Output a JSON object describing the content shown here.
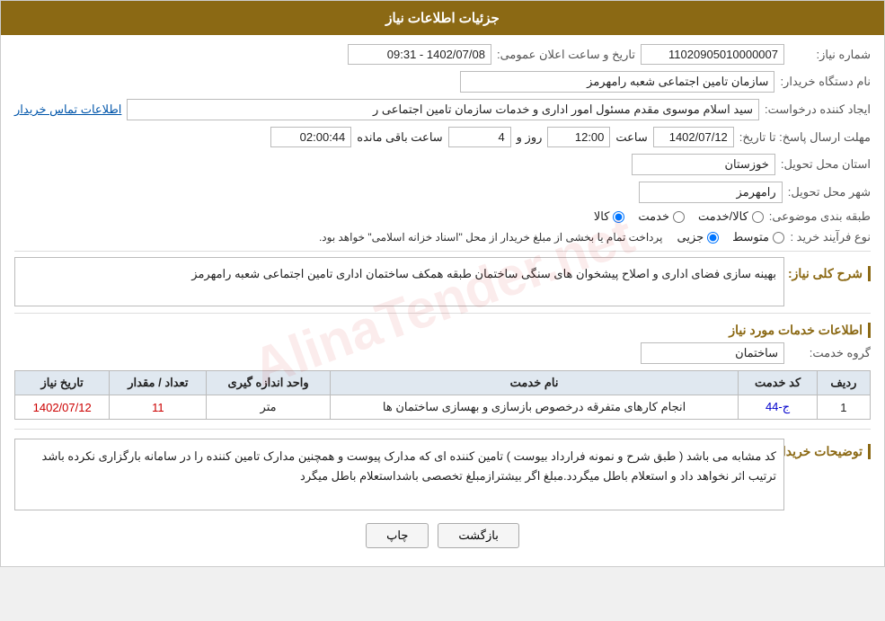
{
  "header": {
    "title": "جزئیات اطلاعات نیاز"
  },
  "fields": {
    "need_number_label": "شماره نیاز:",
    "need_number_value": "11020905010000007",
    "date_label": "تاریخ و ساعت اعلان عمومی:",
    "date_value": "1402/07/08 - 09:31",
    "buyer_label": "نام دستگاه خریدار:",
    "buyer_value": "سازمان تامین اجتماعی شعبه رامهرمز",
    "requester_label": "ایجاد کننده درخواست:",
    "requester_value": "سید اسلام موسوی مقدم مسئول امور اداری و خدمات سازمان تامین اجتماعی ر",
    "requester_link": "اطلاعات تماس خریدار",
    "reply_deadline_label": "مهلت ارسال پاسخ: تا تاریخ:",
    "reply_date": "1402/07/12",
    "reply_time_label": "ساعت",
    "reply_time": "12:00",
    "reply_days_label": "روز و",
    "reply_days": "4",
    "reply_remain_label": "ساعت باقی مانده",
    "reply_remain": "02:00:44",
    "province_label": "استان محل تحویل:",
    "province_value": "خوزستان",
    "city_label": "شهر محل تحویل:",
    "city_value": "رامهرمز",
    "category_label": "طبقه بندی موضوعی:",
    "category_options": [
      "کالا",
      "خدمت",
      "کالا/خدمت"
    ],
    "category_selected": "کالا",
    "purchase_type_label": "نوع فرآیند خرید :",
    "purchase_options": [
      "جزیی",
      "متوسط"
    ],
    "purchase_note": "پرداخت تمام یا بخشی از مبلغ خریدار از محل \"اسناد خزانه اسلامی\" خواهد بود.",
    "description_label": "شرح کلی نیاز:",
    "description_value": "بهینه سازی فضای اداری و اصلاح پیشخوان های سنگی ساختمان طبقه همکف ساختمان اداری تامین اجتماعی شعبه رامهرمز",
    "services_info_title": "اطلاعات خدمات مورد نیاز",
    "service_group_label": "گروه خدمت:",
    "service_group_value": "ساختمان",
    "table_headers": [
      "ردیف",
      "کد خدمت",
      "نام خدمت",
      "واحد اندازه گیری",
      "تعداد / مقدار",
      "تاریخ نیاز"
    ],
    "table_rows": [
      {
        "row": "1",
        "code": "ج-44",
        "name": "انجام کارهای متفرقه درخصوص بازسازی و بهسازی ساختمان ها",
        "unit": "متر",
        "qty": "11",
        "date": "1402/07/12"
      }
    ],
    "buyer_notes_label": "توضیحات خریدار:",
    "buyer_notes_value": "کد مشابه می باشد ( طبق شرح و نمونه فرارداد بیوست ) تامین کننده ای که مدارک پیوست و همچنین مدارک تامین کننده را در سامانه بارگزاری نکرده باشد ترتیب اثر نخواهد داد و استعلام باطل میگردد.مبلغ اگر بیشترازمبلغ تخصصی باشداستعلام باطل میگرد"
  },
  "buttons": {
    "print": "چاپ",
    "back": "بازگشت"
  }
}
